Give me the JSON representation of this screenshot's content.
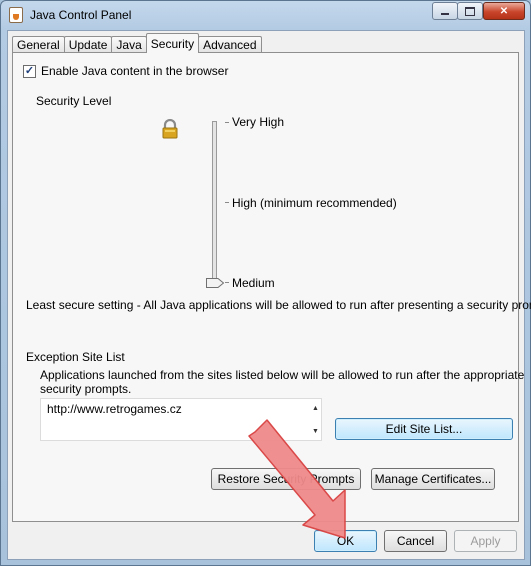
{
  "window": {
    "title": "Java Control Panel",
    "controls": [
      "minimize-icon",
      "maximize-icon",
      "close-icon"
    ],
    "close_glyph": "✕"
  },
  "tabs": [
    {
      "label": "General"
    },
    {
      "label": "Update"
    },
    {
      "label": "Java"
    },
    {
      "label": "Security",
      "active": true
    },
    {
      "label": "Advanced"
    }
  ],
  "security": {
    "enable_label": "Enable Java content in the browser",
    "enable_checked": true,
    "check_glyph": "✓",
    "level_heading": "Security Level",
    "levels": [
      "Very High",
      "High (minimum recommended)",
      "Medium"
    ],
    "selected_level": "Medium",
    "level_description": "Least secure setting - All Java applications will be allowed to run after presenting a security prompt."
  },
  "exception": {
    "heading": "Exception Site List",
    "description_line1": "Applications launched from the sites listed below will be allowed to run after the appropriate",
    "description_line2": "security prompts.",
    "sites": [
      "http://www.retrogames.cz"
    ],
    "edit_button": "Edit Site List..."
  },
  "buttons": {
    "restore": "Restore Security Prompts",
    "manage": "Manage Certificates...",
    "ok": "OK",
    "cancel": "Cancel",
    "apply": "Apply",
    "apply_enabled": false
  },
  "colors": {
    "lock": "#d9a521",
    "arrow_fill": "#f08a8a",
    "arrow_stroke": "#d94040"
  }
}
